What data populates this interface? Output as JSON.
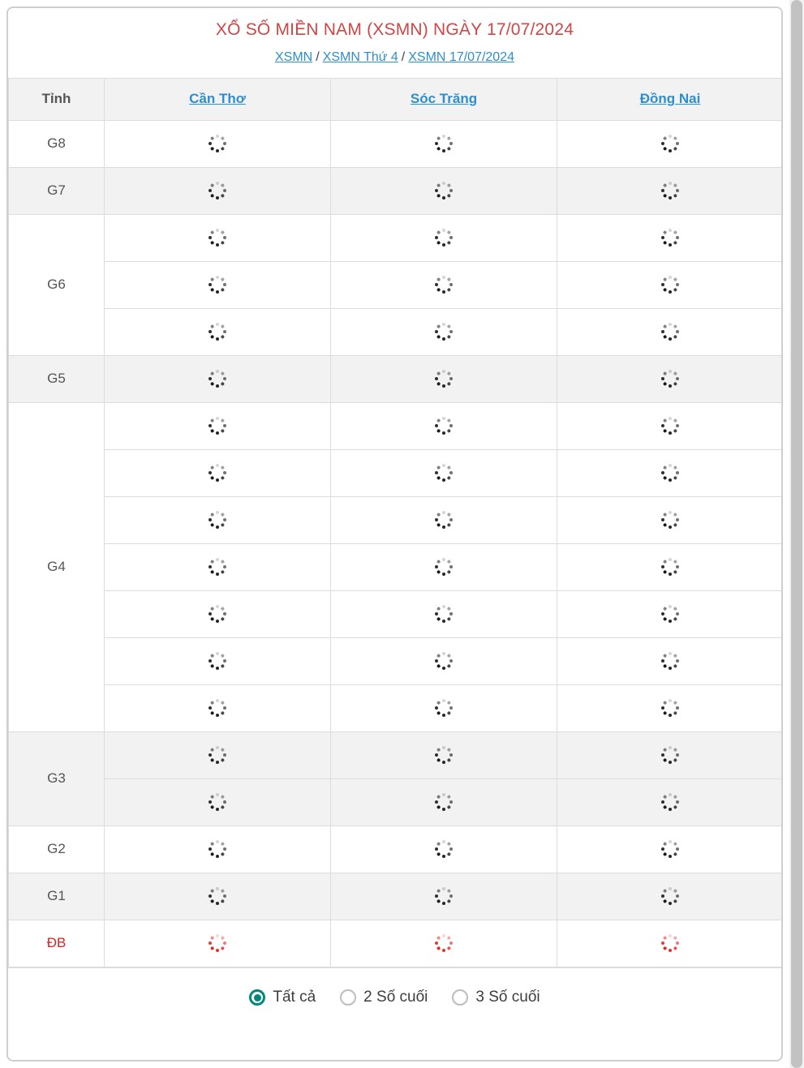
{
  "header": {
    "title": "XỔ SỐ MIỀN NAM (XSMN) NGÀY 17/07/2024",
    "breadcrumb": [
      {
        "label": "XSMN"
      },
      {
        "label": "XSMN Thứ 4"
      },
      {
        "label": "XSMN 17/07/2024"
      }
    ],
    "breadcrumb_separator": "/"
  },
  "table": {
    "label_column_header": "Tỉnh",
    "provinces": [
      {
        "name": "Cần Thơ"
      },
      {
        "name": "Sóc Trăng"
      },
      {
        "name": "Đồng Nai"
      }
    ],
    "prizes": [
      {
        "label": "G8",
        "rows": 1,
        "shaded": false,
        "color": "black",
        "loading": true
      },
      {
        "label": "G7",
        "rows": 1,
        "shaded": true,
        "color": "black",
        "loading": true
      },
      {
        "label": "G6",
        "rows": 3,
        "shaded": false,
        "color": "black",
        "loading": true
      },
      {
        "label": "G5",
        "rows": 1,
        "shaded": true,
        "color": "black",
        "loading": true
      },
      {
        "label": "G4",
        "rows": 7,
        "shaded": false,
        "color": "black",
        "loading": true
      },
      {
        "label": "G3",
        "rows": 2,
        "shaded": true,
        "color": "black",
        "loading": true
      },
      {
        "label": "G2",
        "rows": 1,
        "shaded": false,
        "color": "black",
        "loading": true
      },
      {
        "label": "G1",
        "rows": 1,
        "shaded": true,
        "color": "black",
        "loading": true
      },
      {
        "label": "ĐB",
        "rows": 1,
        "shaded": false,
        "color": "red",
        "loading": true
      }
    ],
    "cell_state": "loading-spinner"
  },
  "filter": {
    "options": [
      {
        "label": "Tất cả",
        "selected": true
      },
      {
        "label": "2 Số cuối",
        "selected": false
      },
      {
        "label": "3 Số cuối",
        "selected": false
      }
    ]
  },
  "colors": {
    "title_red": "#cf4646",
    "link_blue": "#2d8fce",
    "prize_db_red": "#e02020",
    "radio_accent": "#00897b",
    "row_shade": "#f2f2f2",
    "border": "#dcdcdc",
    "card_border": "#cfcfcf"
  }
}
